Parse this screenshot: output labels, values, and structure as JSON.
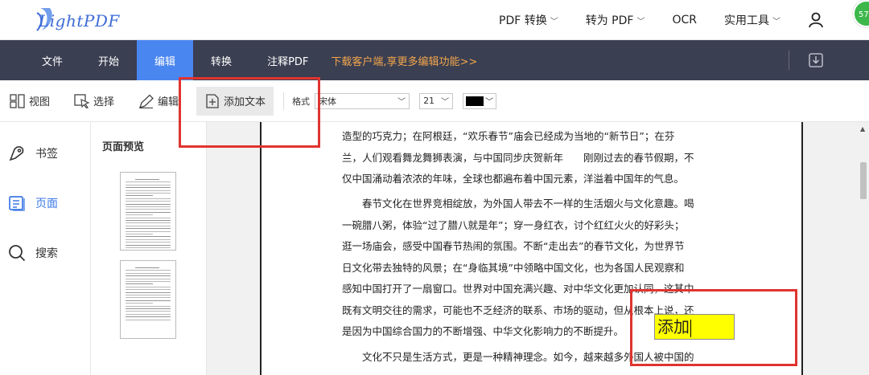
{
  "header": {
    "logo_text": "LightPDF",
    "nav": [
      {
        "label": "PDF 转换",
        "has_dropdown": true
      },
      {
        "label": "转为 PDF",
        "has_dropdown": true
      },
      {
        "label": "OCR",
        "has_dropdown": false
      },
      {
        "label": "实用工具",
        "has_dropdown": true
      }
    ],
    "user_icon": "user-icon",
    "avatar_text": "57"
  },
  "menubar": {
    "items": [
      "文件",
      "开始",
      "编辑",
      "转换",
      "注释PDF"
    ],
    "active": "编辑",
    "promo": "下载客户端,享更多编辑功能>>",
    "download_icon": "download-icon"
  },
  "toolbar": {
    "view": "视图",
    "select": "选择",
    "edit": "编辑",
    "add_text": "添加文本",
    "format_label": "格式",
    "font_value": "宋体",
    "size_value": "21",
    "text_color": "#000000"
  },
  "sidebar": {
    "items": [
      {
        "label": "书签",
        "icon": "bookmark-icon"
      },
      {
        "label": "页面",
        "icon": "pages-icon",
        "active": true
      },
      {
        "label": "搜索",
        "icon": "search-icon"
      }
    ]
  },
  "preview": {
    "title": "页面预览",
    "thumbnails": 2
  },
  "document": {
    "paragraphs": [
      {
        "lines": [
          "造型的巧克力；在阿根廷，“欢乐春节”庙会已经成为当地的“新节日”；在芬",
          "兰，人们观看舞龙舞狮表演，与中国同步庆贺新年　　刚刚过去的春节假期，不",
          "仅中国涌动着浓浓的年味，全球也都遍布着中国元素，洋溢着中国年的气息。"
        ]
      },
      {
        "lines": [
          "　　春节文化在世界竞相绽放，为外国人带去不一样的生活烟火与文化意趣。喝",
          "一碗腊八粥，体验“过了腊八就是年”；穿一身红衣，讨个红红火火的好彩头；",
          "逛一场庙会，感受中国春节热闹的氛围。不断“走出去”的春节文化，为世界节",
          "日文化带去独特的风景；在“身临其境”中领略中国文化，也为各国人民观察和",
          "感知中国打开了一扇窗口。世界对中国充满兴趣、对中华文化更加认同，这其中",
          "既有文明交往的需求，可能也不乏经济的联系、市场的驱动，但从根本上说，还",
          "是因为中国综合国力的不断增强、中华文化影响力的不断提升。"
        ]
      },
      {
        "lines": [
          "　　文化不只是生活方式，更是一种精神理念。如今，越来越多外国人被中国的"
        ]
      }
    ],
    "inserted_text": "添加"
  },
  "colors": {
    "menubar_bg": "#3b3f52",
    "active_tab": "#4a86f0",
    "promo": "#f2a64b",
    "textbox_bg": "#ffff00",
    "highlight": "#e0342f"
  }
}
